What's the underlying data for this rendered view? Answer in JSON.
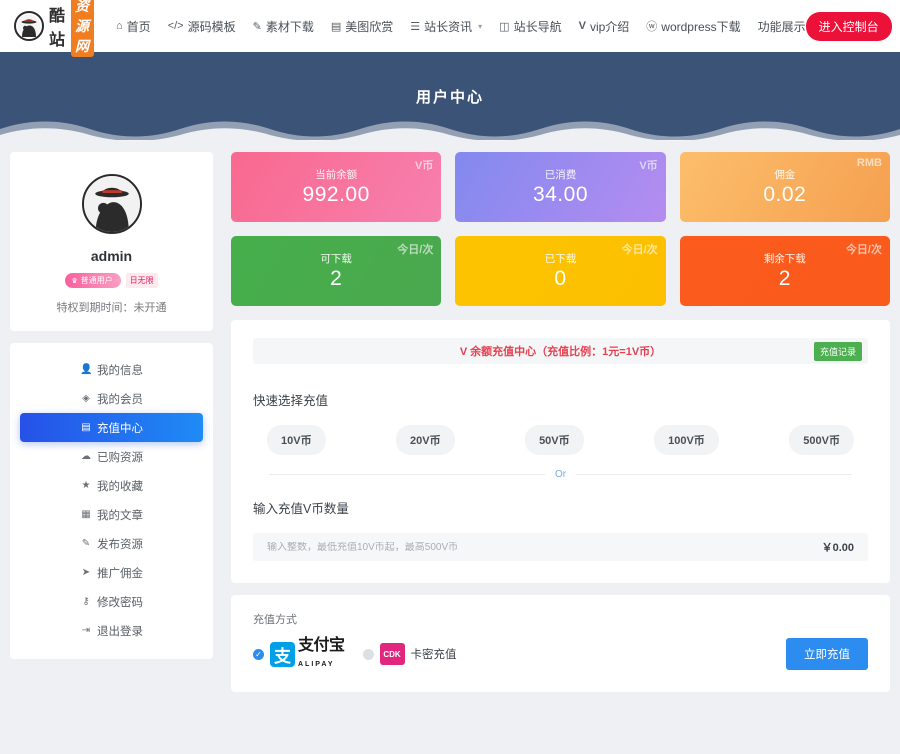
{
  "nav": {
    "logo_text": "酷站",
    "logo_badge": "资源网",
    "logo_icon": "detective-icon",
    "items": [
      {
        "label": "首页",
        "icon": "home-icon",
        "caret": false
      },
      {
        "label": "源码模板",
        "icon": "code-icon",
        "caret": false
      },
      {
        "label": "素材下载",
        "icon": "pen-icon",
        "caret": false
      },
      {
        "label": "美图欣赏",
        "icon": "image-icon",
        "caret": false
      },
      {
        "label": "站长资讯",
        "icon": "list-icon",
        "caret": true
      },
      {
        "label": "站长导航",
        "icon": "compass-icon",
        "caret": false
      },
      {
        "label": "vip介绍",
        "icon": "v-icon",
        "caret": false
      },
      {
        "label": "wordpress下载",
        "icon": "wordpress-icon",
        "caret": false
      },
      {
        "label": "功能展示",
        "icon": "",
        "caret": false
      }
    ],
    "console_button": "进入控制台",
    "search_icon": "search-icon",
    "theme_icon": "contrast-icon",
    "accent_red": "#eb1138",
    "accent_blue": "#2d8cf0"
  },
  "hero": {
    "title": "用户中心",
    "bg_color": "#3b5377"
  },
  "profile": {
    "avatar_icon": "detective-avatar",
    "username": "admin",
    "badge_user": "普通用户",
    "badge_day": "日无限",
    "privilege_text": "特权到期时间：未开通"
  },
  "sidebar": {
    "items": [
      {
        "label": "我的信息",
        "icon": "user-icon",
        "active": false
      },
      {
        "label": "我的会员",
        "icon": "diamond-icon",
        "active": false
      },
      {
        "label": "充值中心",
        "icon": "card-icon",
        "active": true
      },
      {
        "label": "已购资源",
        "icon": "cloud-icon",
        "active": false
      },
      {
        "label": "我的收藏",
        "icon": "star-icon",
        "active": false
      },
      {
        "label": "我的文章",
        "icon": "document-icon",
        "active": false
      },
      {
        "label": "发布资源",
        "icon": "pencil-icon",
        "active": false
      },
      {
        "label": "推广佣金",
        "icon": "send-icon",
        "active": false
      },
      {
        "label": "修改密码",
        "icon": "key-icon",
        "active": false
      },
      {
        "label": "退出登录",
        "icon": "logout-icon",
        "active": false
      }
    ]
  },
  "stats": [
    {
      "label": "当前余额",
      "value": "992.00",
      "unit": "V币",
      "color_from": "#f8698f",
      "color_to": "#f77fae"
    },
    {
      "label": "已消费",
      "value": "34.00",
      "unit": "V币",
      "color_from": "#8289ef",
      "color_to": "#b58cf0"
    },
    {
      "label": "佣金",
      "value": "0.02",
      "unit": "RMB",
      "color_from": "#fcbe6b",
      "color_to": "#f5a050"
    },
    {
      "label": "可下载",
      "value": "2",
      "unit": "今日/次",
      "color_from": "#46af4b",
      "color_to": "#4aa84e"
    },
    {
      "label": "已下载",
      "value": "0",
      "unit": "今日/次",
      "color_from": "#fdc300",
      "color_to": "#fcc000"
    },
    {
      "label": "剩余下载",
      "value": "2",
      "unit": "今日/次",
      "color_from": "#fb5c1d",
      "color_to": "#fa5a1c"
    }
  ],
  "recharge": {
    "notice_symbol": "V",
    "notice": "余额充值中心（充值比例：1元=1V币）",
    "record_button": "充值记录",
    "quick_label": "快速选择充值",
    "quick_options": [
      "10V币",
      "20V币",
      "50V币",
      "100V币",
      "500V币"
    ],
    "or_text": "Or",
    "input_label": "输入充值V币数量",
    "input_placeholder": "输入整数，最低充值10V币起，最高500V币",
    "input_value": "",
    "total": "￥0.00"
  },
  "payment": {
    "label": "充值方式",
    "methods": [
      {
        "name": "支付宝",
        "sub": "ALIPAY",
        "icon": "alipay-icon",
        "selected": true
      },
      {
        "name": "卡密充值",
        "sub": "CDK",
        "icon": "cdk-icon",
        "selected": false
      }
    ],
    "submit_button": "立即充值"
  }
}
